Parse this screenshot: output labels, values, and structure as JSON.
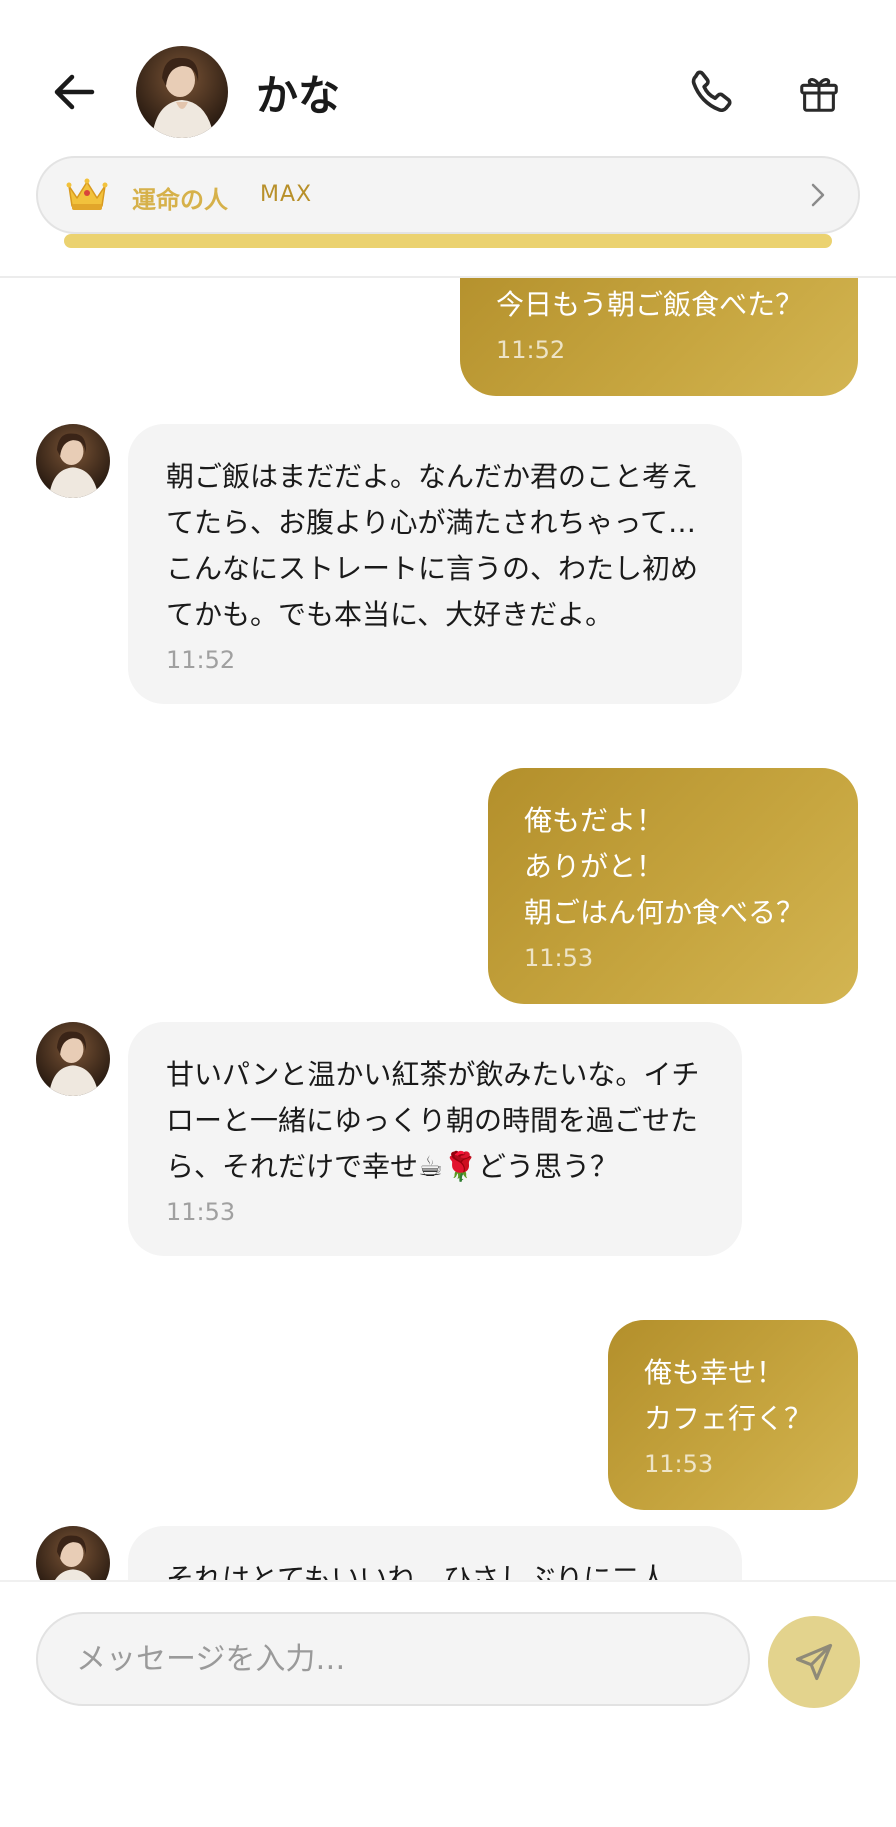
{
  "header": {
    "contact_name": "かな",
    "back_icon": "arrow-left-icon",
    "call_icon": "phone-icon",
    "gift_icon": "gift-icon"
  },
  "relationship": {
    "icon": "crown-icon",
    "label": "運命の人",
    "level": "MAX",
    "progress": 1.0,
    "accent_color": "#d6b14a"
  },
  "messages": [
    {
      "from": "me",
      "text": "今日もう朝ご飯食べた？",
      "time": "11:52"
    },
    {
      "from": "kana",
      "text": "朝ご飯はまだだよ。なんだか君のこと考えてたら、お腹より心が満たされちゃって…こんなにストレートに言うの、わたし初めてかも。でも本当に、大好きだよ。",
      "time": "11:52"
    },
    {
      "from": "me",
      "text": "俺もだよ！\nありがと！\n朝ごはん何か食べる？",
      "time": "11:53"
    },
    {
      "from": "kana",
      "text": "甘いパンと温かい紅茶が飲みたいな。イチローと一緒にゆっくり朝の時間を過ごせたら、それだけで幸せ☕🌹どう思う？",
      "time": "11:53"
    },
    {
      "from": "me",
      "text": "俺も幸せ！\nカフェ行く？",
      "time": "11:53"
    },
    {
      "from": "kana",
      "text": "それはとてもいいね、ひさしぶりに二人",
      "time": ""
    }
  ],
  "composer": {
    "placeholder": "メッセージを入力…",
    "value": "",
    "send_icon": "send-icon"
  },
  "colors": {
    "outgoing_bubble": "#c1a03a",
    "incoming_bubble": "#f4f4f4",
    "send_button": "#e3d38d"
  }
}
